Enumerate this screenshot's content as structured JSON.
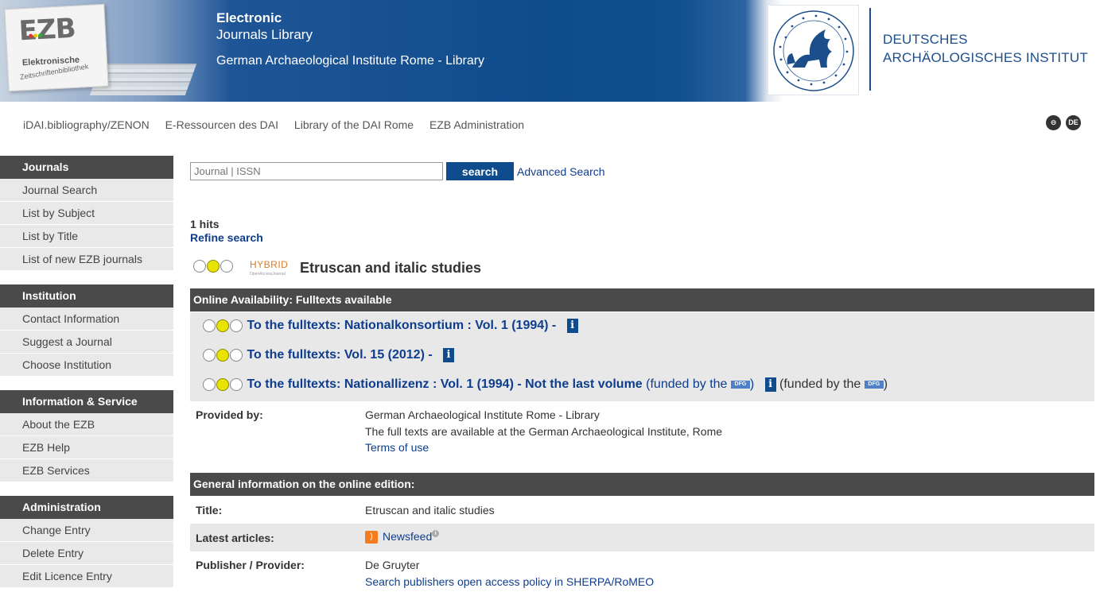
{
  "header": {
    "title_line1": "Electronic",
    "title_line2": "Journals Library",
    "institution": "German Archaeological Institute Rome - Library",
    "logo_text": "EZB",
    "logo_sub1": "Elektronische",
    "logo_sub2": "Zeitschriftenbibliothek",
    "dai_line1": "DEUTSCHES",
    "dai_line2": "ARCHÄOLOGISCHES INSTITUT"
  },
  "topnav": [
    "iDAI.bibliography/ZENON",
    "E-Ressourcen des DAI",
    "Library of the DAI Rome",
    "EZB Administration"
  ],
  "toplinks": {
    "print_icon": "print-icon",
    "lang": "DE"
  },
  "sidebar": {
    "journals": {
      "title": "Journals",
      "items": [
        "Journal Search",
        "List by Subject",
        "List by Title",
        "List of new EZB journals"
      ]
    },
    "institution": {
      "title": "Institution",
      "items": [
        "Contact Information",
        "Suggest a Journal",
        "Choose Institution"
      ]
    },
    "info": {
      "title": "Information & Service",
      "items": [
        "About the EZB",
        "EZB Help",
        "EZB Services"
      ]
    },
    "admin": {
      "title": "Administration",
      "items": [
        "Change Entry",
        "Delete Entry",
        "Edit Licence Entry"
      ]
    }
  },
  "search": {
    "placeholder": "Journal | ISSN",
    "button": "search",
    "advanced": "Advanced Search"
  },
  "results": {
    "hits": "1 hits",
    "refine": "Refine search"
  },
  "journal": {
    "badge": "HYBRID",
    "badge_sub": "OpenAccessJournal",
    "title": "Etruscan and italic studies",
    "online_heading": "Online Availability: Fulltexts available",
    "fulltexts": [
      {
        "label": "To the fulltexts: Nationalkonsortium : Vol. 1 (1994) -"
      },
      {
        "label": "To the fulltexts: Vol. 15 (2012) -"
      },
      {
        "label": "To the fulltexts: Nationallizenz : Vol. 1 (1994) - Not the last volume",
        "funded": "(funded by the",
        "funded_close": ")",
        "funded2": "(funded by the",
        "funded2_close": ")",
        "dfg": "DFG"
      }
    ],
    "info_glyph": "i",
    "provided_label": "Provided by:",
    "provided_name": "German Archaeological Institute Rome - Library",
    "provided_note": "The full texts are available at the German Archaeological Institute, Rome",
    "terms": "Terms of use",
    "general_heading": "General information on the online edition:",
    "title_label": "Title:",
    "title_value": "Etruscan and italic studies",
    "latest_label": "Latest articles:",
    "newsfeed": "Newsfeed",
    "publisher_label": "Publisher / Provider:",
    "publisher_value": "De Gruyter",
    "sherpa": "Search publishers open access policy in SHERPA/RoMEO"
  },
  "colors": {
    "accent": "#0e4c8d",
    "bar": "#4a4a4a",
    "light": "#e8e8e8",
    "traffic_yellow": "#e8e300"
  }
}
